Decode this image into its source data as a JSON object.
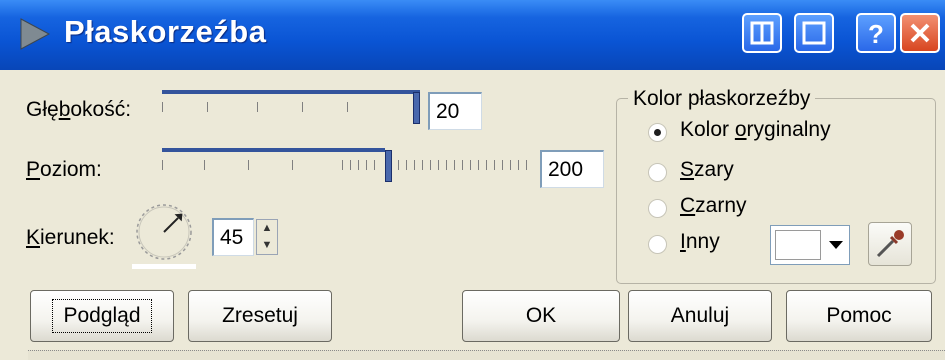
{
  "window": {
    "title": "Płaskorzeźba",
    "controls": [
      "columns-icon",
      "maximize-icon",
      "help-icon",
      "close-icon"
    ]
  },
  "depth": {
    "label_pre": "Głę",
    "label_u": "b",
    "label_post": "okość:",
    "value": "20",
    "level": 1.0
  },
  "level": {
    "label_pre": "",
    "label_u": "P",
    "label_post": "oziom:",
    "value": "200",
    "level": 0.62
  },
  "direction": {
    "label_pre": "",
    "label_u": "K",
    "label_post": "ierunek:",
    "value": "45",
    "angle_deg": 45
  },
  "color_group": {
    "title": "Kolor płaskorzeźby",
    "options": [
      {
        "pre": "Kolor ",
        "u": "o",
        "post": "ryginalny",
        "checked": true
      },
      {
        "pre": "",
        "u": "S",
        "post": "zary",
        "checked": false
      },
      {
        "pre": "",
        "u": "C",
        "post": "zarny",
        "checked": false
      },
      {
        "pre": "",
        "u": "I",
        "post": "nny",
        "checked": false
      }
    ],
    "swatch_color": "#ffffff"
  },
  "buttons": {
    "preview": "Podgląd",
    "reset": "Zresetuj",
    "ok": "OK",
    "cancel": "Anuluj",
    "help": "Pomoc"
  },
  "colors": {
    "titlebar": "#0a54d4",
    "dialog_bg": "#ece9d8",
    "close_button": "#d84620"
  }
}
